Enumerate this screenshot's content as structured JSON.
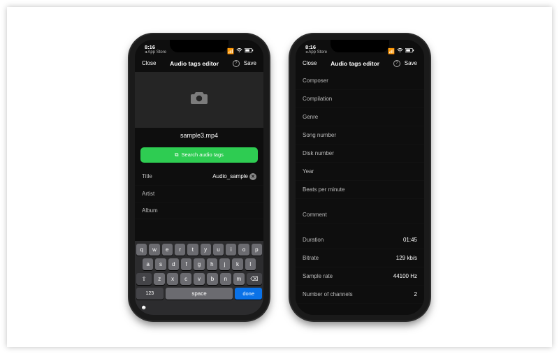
{
  "status": {
    "time": "8:16",
    "back": "◂ App Store",
    "signal": "••ıl",
    "wifi": "⏚",
    "battery": "▮▯"
  },
  "nav": {
    "close": "Close",
    "title": "Audio tags editor",
    "help": "?",
    "save": "Save"
  },
  "left": {
    "filename": "sample3.mp4",
    "search_label": "Search audio tags",
    "fields": {
      "title_label": "Title",
      "title_value": "Audio_sample",
      "artist_label": "Artist",
      "album_label": "Album"
    },
    "keyboard": {
      "num": "123",
      "space": "space",
      "done": "done"
    }
  },
  "right": {
    "rows": [
      {
        "label": "Composer",
        "value": ""
      },
      {
        "label": "Compilation",
        "value": ""
      },
      {
        "label": "Genre",
        "value": ""
      },
      {
        "label": "Song number",
        "value": ""
      },
      {
        "label": "Disk number",
        "value": ""
      },
      {
        "label": "Year",
        "value": ""
      },
      {
        "label": "Beats per minute",
        "value": ""
      }
    ],
    "comment_label": "Comment",
    "info": [
      {
        "label": "Duration",
        "value": "01:45"
      },
      {
        "label": "Bitrate",
        "value": "129 kb/s"
      },
      {
        "label": "Sample rate",
        "value": "44100 Hz"
      },
      {
        "label": "Number of channels",
        "value": "2"
      }
    ]
  }
}
